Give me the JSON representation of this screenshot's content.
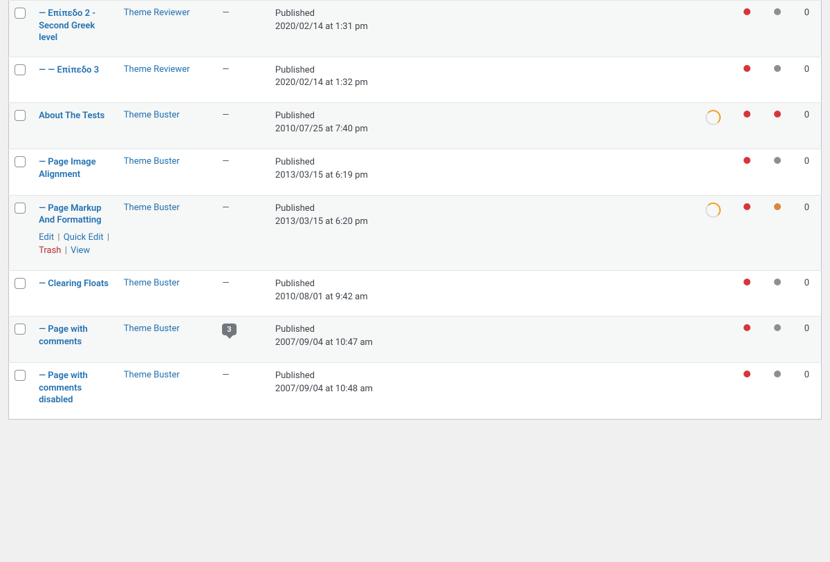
{
  "actions": {
    "edit": "Edit",
    "quick_edit": "Quick Edit",
    "trash": "Trash",
    "view": "View"
  },
  "rows": [
    {
      "alt": true,
      "title": "— Επίπεδο 2 - Second Greek level",
      "author": "Theme Reviewer",
      "comments_dash": "—",
      "status": "Published",
      "timestamp": "2020/02/14 at 1:31 pm",
      "spinner": false,
      "dot1": "red",
      "dot2": "gray",
      "count": "0",
      "show_actions": false
    },
    {
      "alt": false,
      "title": "— — Επίπεδο 3",
      "author": "Theme Reviewer",
      "comments_dash": "—",
      "status": "Published",
      "timestamp": "2020/02/14 at 1:32 pm",
      "spinner": false,
      "dot1": "red",
      "dot2": "gray",
      "count": "0",
      "show_actions": false
    },
    {
      "alt": true,
      "title": "About The Tests",
      "author": "Theme Buster",
      "comments_dash": "—",
      "status": "Published",
      "timestamp": "2010/07/25 at 7:40 pm",
      "spinner": true,
      "dot1": "red",
      "dot2": "red",
      "count": "0",
      "show_actions": false
    },
    {
      "alt": false,
      "title": "— Page Image Alignment",
      "author": "Theme Buster",
      "comments_dash": "—",
      "status": "Published",
      "timestamp": "2013/03/15 at 6:19 pm",
      "spinner": false,
      "dot1": "red",
      "dot2": "gray",
      "count": "0",
      "show_actions": false
    },
    {
      "alt": true,
      "title": "— Page Markup And Formatting",
      "author": "Theme Buster",
      "comments_dash": "—",
      "status": "Published",
      "timestamp": "2013/03/15 at 6:20 pm",
      "spinner": true,
      "dot1": "red",
      "dot2": "orange",
      "count": "0",
      "show_actions": true
    },
    {
      "alt": false,
      "title": "— Clearing Floats",
      "author": "Theme Buster",
      "comments_dash": "—",
      "status": "Published",
      "timestamp": "2010/08/01 at 9:42 am",
      "spinner": false,
      "dot1": "red",
      "dot2": "gray",
      "count": "0",
      "show_actions": false
    },
    {
      "alt": true,
      "title": "— Page with comments",
      "author": "Theme Buster",
      "comments_bubble": "3",
      "status": "Published",
      "timestamp": "2007/09/04 at 10:47 am",
      "spinner": false,
      "dot1": "red",
      "dot2": "gray",
      "count": "0",
      "show_actions": false
    },
    {
      "alt": false,
      "title": "— Page with comments disabled",
      "author": "Theme Buster",
      "comments_dash": "—",
      "status": "Published",
      "timestamp": "2007/09/04 at 10:48 am",
      "spinner": false,
      "dot1": "red",
      "dot2": "gray",
      "count": "0",
      "show_actions": false
    }
  ]
}
